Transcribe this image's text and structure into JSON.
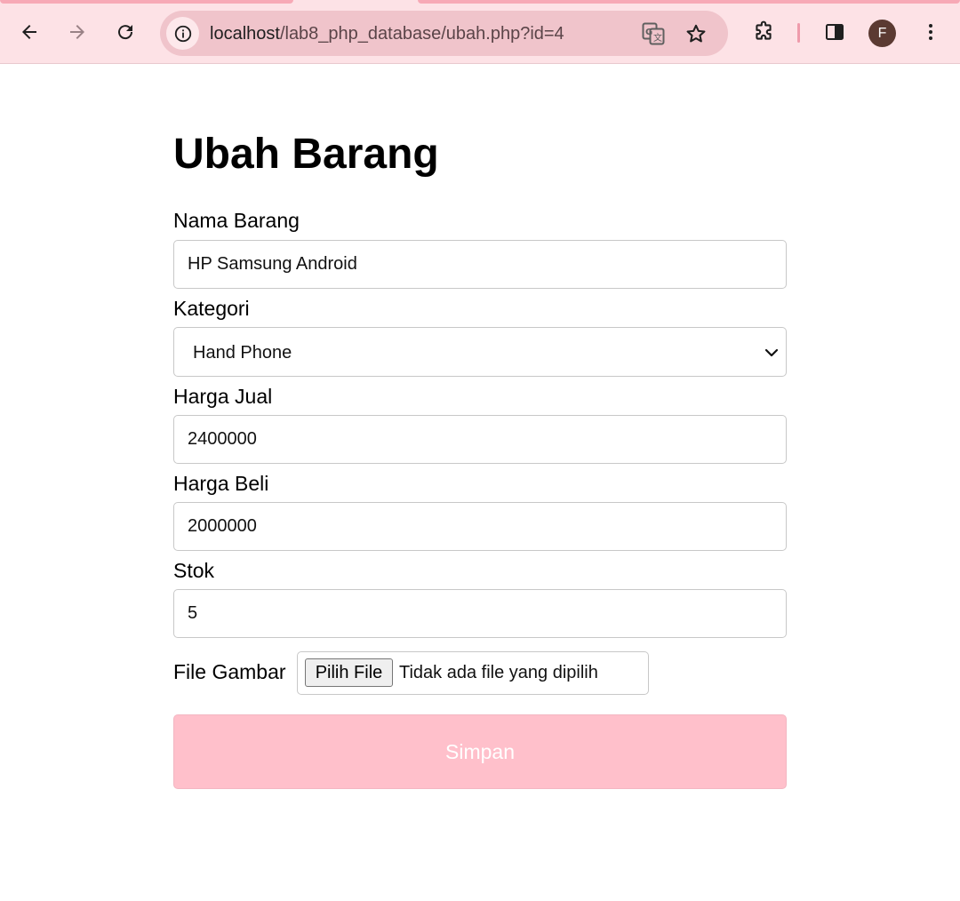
{
  "browser": {
    "url_host": "localhost",
    "url_path": "/lab8_php_database/ubah.php?id=4",
    "profile_initial": "F",
    "accent_color": "#fde2e6"
  },
  "page": {
    "title": "Ubah Barang"
  },
  "form": {
    "nama_barang": {
      "label": "Nama Barang",
      "value": "HP Samsung Android"
    },
    "kategori": {
      "label": "Kategori",
      "selected": "Hand Phone"
    },
    "harga_jual": {
      "label": "Harga Jual",
      "value": "2400000"
    },
    "harga_beli": {
      "label": "Harga Beli",
      "value": "2000000"
    },
    "stok": {
      "label": "Stok",
      "value": "5"
    },
    "file_gambar": {
      "label": "File Gambar",
      "button": "Pilih File",
      "status": "Tidak ada file yang dipilih"
    },
    "submit": {
      "label": "Simpan",
      "color": "#ffc0cb"
    }
  },
  "icons": {
    "back": "arrow-left-icon",
    "forward": "arrow-right-icon",
    "reload": "reload-icon",
    "site_info": "info-icon",
    "translate": "translate-icon",
    "bookmark": "star-icon",
    "extensions": "puzzle-icon",
    "side_panel": "side-panel-icon",
    "menu": "kebab-menu-icon"
  }
}
